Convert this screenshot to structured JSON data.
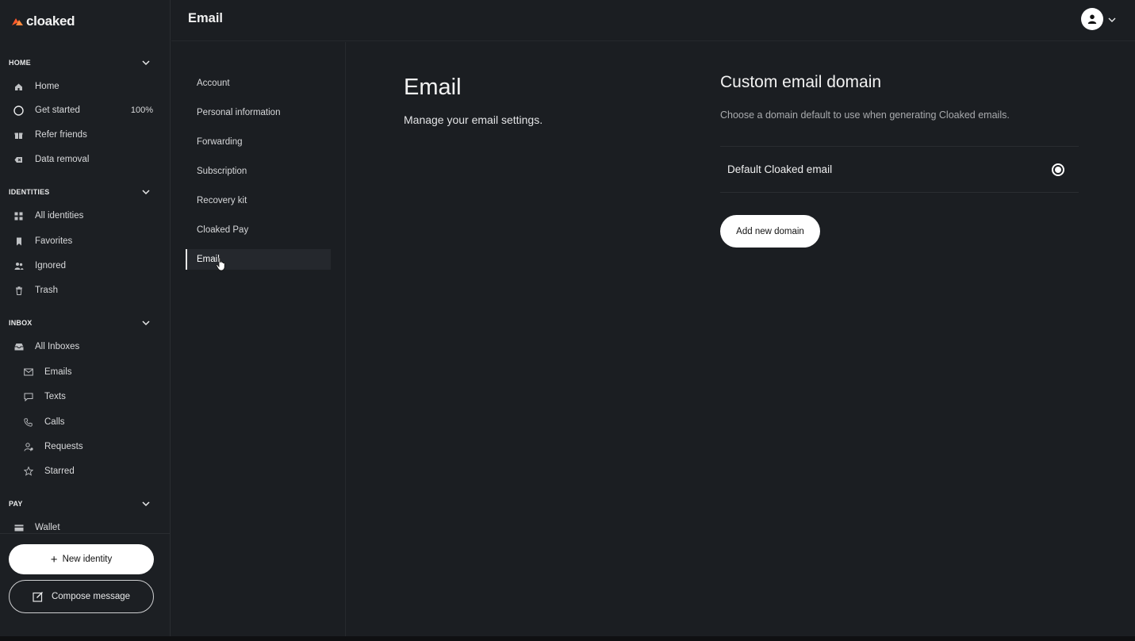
{
  "app": {
    "logo_text": "cloaked",
    "accent_color": "#ff5a2b"
  },
  "sidebar": {
    "sections": [
      {
        "title": "HOME",
        "items": [
          {
            "label": "Home",
            "icon": "home-icon"
          },
          {
            "label": "Get started",
            "icon": "circle-icon",
            "badge": "100%"
          },
          {
            "label": "Refer friends",
            "icon": "gift-icon"
          },
          {
            "label": "Data removal",
            "icon": "eraser-icon"
          }
        ]
      },
      {
        "title": "IDENTITIES",
        "items": [
          {
            "label": "All identities",
            "icon": "grid-icon"
          },
          {
            "label": "Favorites",
            "icon": "bookmark-icon"
          },
          {
            "label": "Ignored",
            "icon": "ignored-users-icon"
          },
          {
            "label": "Trash",
            "icon": "trash-icon"
          }
        ]
      },
      {
        "title": "INBOX",
        "items": [
          {
            "label": "All Inboxes",
            "icon": "inbox-icon"
          },
          {
            "label": "Emails",
            "icon": "mail-icon"
          },
          {
            "label": "Texts",
            "icon": "chat-bubble-icon"
          },
          {
            "label": "Calls",
            "icon": "phone-icon"
          },
          {
            "label": "Requests",
            "icon": "user-request-icon"
          },
          {
            "label": "Starred",
            "icon": "star-icon"
          }
        ]
      },
      {
        "title": "PAY",
        "items": [
          {
            "label": "Wallet",
            "icon": "wallet-icon"
          }
        ]
      }
    ],
    "new_identity_label": "New identity",
    "compose_label": "Compose message"
  },
  "header": {
    "title": "Email"
  },
  "settings_nav": {
    "items": [
      "Account",
      "Personal information",
      "Forwarding",
      "Subscription",
      "Recovery kit",
      "Cloaked Pay",
      "Email"
    ],
    "active": "Email"
  },
  "main": {
    "title": "Email",
    "subtitle": "Manage your email settings.",
    "custom_domain": {
      "title": "Custom email domain",
      "description": "Choose a domain default to use when generating Cloaked emails.",
      "option_label": "Default Cloaked email",
      "option_selected": true,
      "add_button": "Add new domain"
    }
  }
}
